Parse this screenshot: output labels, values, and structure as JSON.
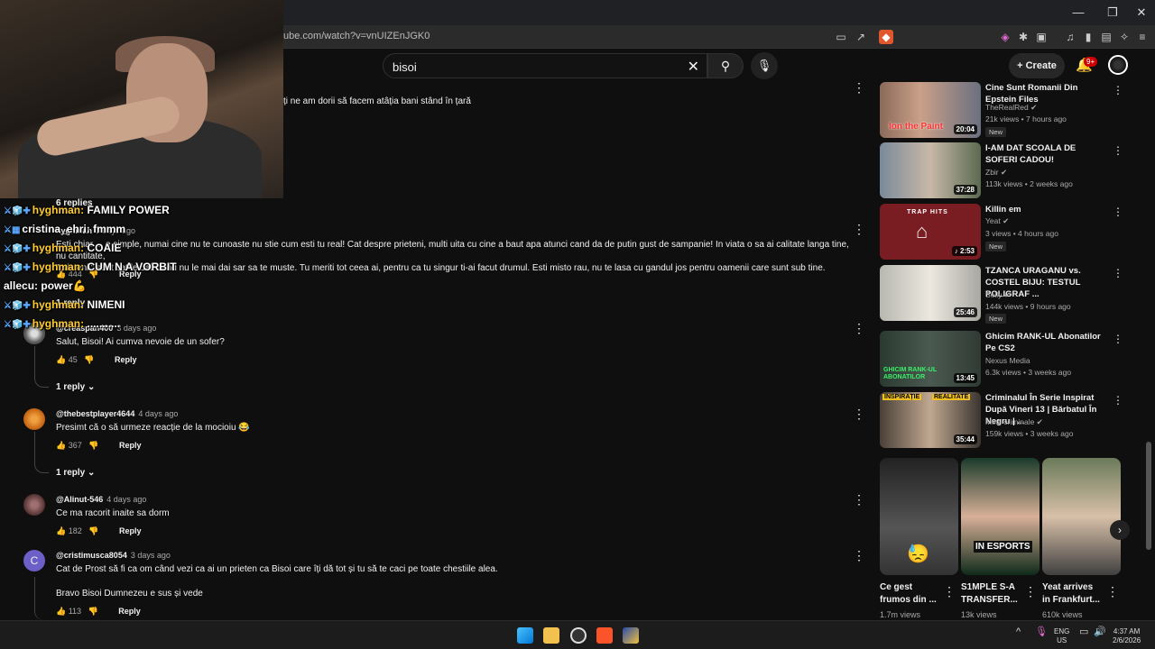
{
  "browser": {
    "url": "ube.com/watch?v=vnUIZEnJGK0",
    "window_controls": [
      "—",
      "❐",
      "✕"
    ]
  },
  "header": {
    "search_value": "bisoi",
    "create_label": "Create",
    "notif_count": "9+"
  },
  "comments": [
    {
      "text": "ți ne am dorii să  facem atâția bani stând în țară"
    },
    {
      "replies": "6 replies"
    },
    {
      "author": "hyghman",
      "ago": "3 days ago",
      "text1": "Esti chiar ... e simple, numai cine nu te cunoaste nu stie cum esti tu real! Cat despre prieteni, multi uita cu cine a baut apa atunci cand da de putin gust de sampanie! In viata o sa ai calitate langa tine, nu cantitate,",
      "text2": "\"prietenii\" sunt cat le dai, cand nu le mai dai sar sa te muste. Tu meriti tot ceea ai, pentru ca tu singur ti-ai facut drumul. Esti misto rau, nu te lasa cu gandul jos pentru oamenii care sunt sub tine.",
      "likes": "444",
      "reply": "Reply",
      "replies": "1 reply"
    },
    {
      "author": "@creaspan400",
      "ago": "3 days ago",
      "text": "Salut, Bisoi! Ai cumva nevoie de un sofer?",
      "likes": "45",
      "reply": "Reply",
      "replies": "1 reply"
    },
    {
      "author": "@thebestplayer4644",
      "ago": "4 days ago",
      "text": "Presimt că o să urmeze reacție de la mocioiu 😂",
      "likes": "367",
      "reply": "Reply",
      "replies": "1 reply"
    },
    {
      "author": "@Alinut-546",
      "ago": "4 days ago",
      "text": "Ce ma racorit inaite sa dorm",
      "likes": "182",
      "reply": "Reply"
    },
    {
      "author": "@cristimusca8054",
      "ago": "3 days ago",
      "initial": "C",
      "text1": "Cat de Prost să fi ca om când vezi ca ai un prieten ca Bisoi care îți dă tot și tu să te caci pe toate chestiile alea.",
      "text2": "Bravo Bisoi Dumnezeu e sus și vede",
      "likes": "113",
      "reply": "Reply"
    }
  ],
  "chat": [
    {
      "user": "hyghman:",
      "msg": "FAMILY POWER"
    },
    {
      "user": "cristina_ehri:",
      "msg": "fmmm"
    },
    {
      "user": "hyghman:",
      "msg": "COAIE"
    },
    {
      "user": "hyghman:",
      "msg": "CUM N A VORBIT"
    },
    {
      "user": "allecu:",
      "msg": "power💪"
    },
    {
      "user": "hyghman:",
      "msg": "NIMENI"
    },
    {
      "user": "hyghman:",
      "msg": "..........."
    }
  ],
  "sidebar": [
    {
      "title": "Cine Sunt Romanii Din Epstein Files",
      "channel": "TheRealRed ✔",
      "meta": "21k views • 7 hours ago",
      "new": "New",
      "duration": "20:04",
      "thumb_text": "Ion the Paint"
    },
    {
      "title": "I-AM DAT SCOALA DE SOFERI CADOU!",
      "channel": "Zbir ✔",
      "meta": "113k views • 2 weeks ago",
      "duration": "37:28"
    },
    {
      "title": "Killin em",
      "channel": "Yeat ✔",
      "meta": "3 views • 4 hours ago",
      "new": "New",
      "duration": "♪ 2:53",
      "thumb_text": "TRAP HITS"
    },
    {
      "title": "TZANCA URAGANU vs. COSTEL BIJU: TESTUL POLIGRAF ...",
      "channel": "Selly ✔",
      "meta": "144k views • 9 hours ago",
      "new": "New",
      "duration": "25:46"
    },
    {
      "title": "Ghicim RANK-UL Abonatilor Pe CS2",
      "channel": "Nexus Media",
      "meta": "6.3k views • 3 weeks ago",
      "duration": "13:45",
      "thumb_text": "GHICIM RANK-UL ABONATILOR"
    },
    {
      "title": "Criminalul În Serie Inspirat După Vineri 13 | Bărbatul În Negru | ...",
      "channel": "Minti criminale ✔",
      "meta": "159k views • 3 weeks ago",
      "duration": "35:44",
      "thumb_text_a": "INSPIRAȚIE",
      "thumb_text_b": "REALITATE"
    }
  ],
  "shorts": [
    {
      "title": "Ce gest frumos din ...",
      "views": "1.7m views"
    },
    {
      "title": "S1MPLE S-A TRANSFER...",
      "views": "13k views",
      "overlay": "IN ESPORTS"
    },
    {
      "title": "Yeat arrives in Frankfurt...",
      "views": "610k views"
    }
  ],
  "taskbar": {
    "lang1": "ENG",
    "lang2": "US",
    "time": "4:37 AM",
    "date": "2/6/2026"
  }
}
